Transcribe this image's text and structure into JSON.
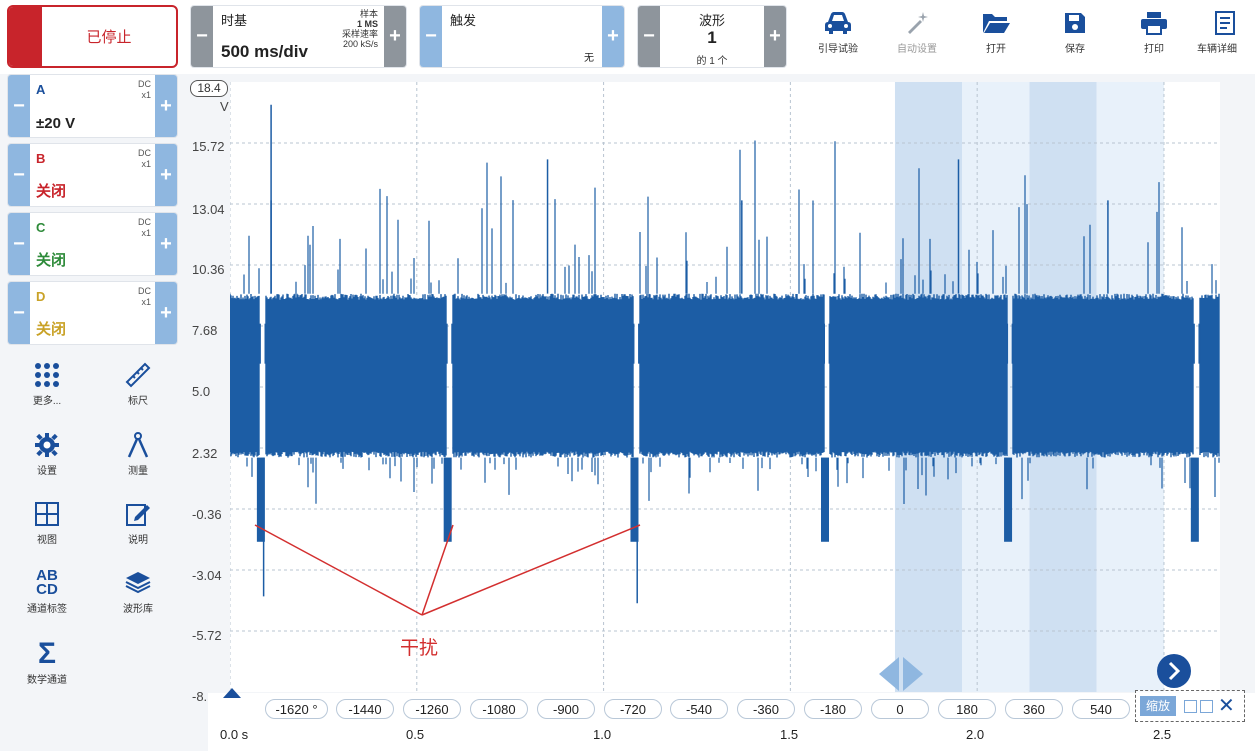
{
  "run": {
    "label": "已停止"
  },
  "timebase": {
    "label": "时基",
    "value": "500 ms/div",
    "samples_label": "样本",
    "samples": "1 MS",
    "rate_label": "采样速率",
    "rate": "200 kS/s"
  },
  "trigger": {
    "label": "触发",
    "mode": "无"
  },
  "waveform": {
    "label": "波形",
    "index": "1",
    "total": "的 1 个"
  },
  "toolbar": [
    {
      "label": "引导试验",
      "icon": "car-icon"
    },
    {
      "label": "自动设置",
      "icon": "magic-wand-icon",
      "disabled": true
    },
    {
      "label": "打开",
      "icon": "folder-icon"
    },
    {
      "label": "保存",
      "icon": "save-icon"
    },
    {
      "label": "打印",
      "icon": "print-icon"
    },
    {
      "label": "车辆详细",
      "icon": "vehicle-details-icon"
    }
  ],
  "channels": [
    {
      "name": "A",
      "coupling": "DC",
      "probe": "x1",
      "range": "±20 V",
      "color": "#1a4f9c",
      "range_color": "#222222"
    },
    {
      "name": "B",
      "coupling": "DC",
      "probe": "x1",
      "range": "关闭",
      "color": "#c8242b",
      "range_color": "#c8242b"
    },
    {
      "name": "C",
      "coupling": "DC",
      "probe": "x1",
      "range": "关闭",
      "color": "#2e8b3a",
      "range_color": "#2e8b3a"
    },
    {
      "name": "D",
      "coupling": "DC",
      "probe": "x1",
      "range": "关闭",
      "color": "#c9a227",
      "range_color": "#c9a227"
    }
  ],
  "side_tools": [
    {
      "label": "更多...",
      "icon": "dots-grid-icon"
    },
    {
      "label": "标尺",
      "icon": "ruler-icon"
    },
    {
      "label": "设置",
      "icon": "gear-icon"
    },
    {
      "label": "测量",
      "icon": "compass-icon"
    },
    {
      "label": "视图",
      "icon": "grid-view-icon"
    },
    {
      "label": "说明",
      "icon": "note-edit-icon"
    },
    {
      "label": "通道标签",
      "icon": "channel-labels-icon",
      "glyph_top": "AB",
      "glyph_bottom": "CD"
    },
    {
      "label": "波形库",
      "icon": "waveform-library-icon"
    },
    {
      "label": "数学通道",
      "icon": "sigma-icon"
    }
  ],
  "plot": {
    "y_top_box": "18.4",
    "y_unit": "V",
    "y_ticks": [
      "15.72",
      "13.04",
      "10.36",
      "7.68",
      "5.0",
      "2.32",
      "-0.36",
      "-3.04",
      "-5.72",
      "-8."
    ],
    "degree_ticks": [
      "-1620 °",
      "-1440",
      "-1260",
      "-1080",
      "-900",
      "-720",
      "-540",
      "-360",
      "-180",
      "0",
      "180",
      "360",
      "540"
    ],
    "x_ticks": [
      "0.0 s",
      "0.5",
      "1.0",
      "1.5",
      "2.0",
      "2.5"
    ],
    "annotation": "干扰",
    "zoom_label": "缩放"
  },
  "chart_data": {
    "type": "line",
    "title": "",
    "xlabel": "",
    "ylabel": "V",
    "xlim": [
      0,
      2.65
    ],
    "ylim": [
      -8.4,
      18.4
    ],
    "series": [
      {
        "values_desc": "dense noisy signal",
        "band_top": 9.1,
        "band_bottom": 1.9,
        "center": 4.5,
        "dropout_times": [
          0.08,
          0.58,
          1.08,
          1.59,
          2.08,
          2.58
        ],
        "dropout_min": -1.8
      }
    ]
  }
}
